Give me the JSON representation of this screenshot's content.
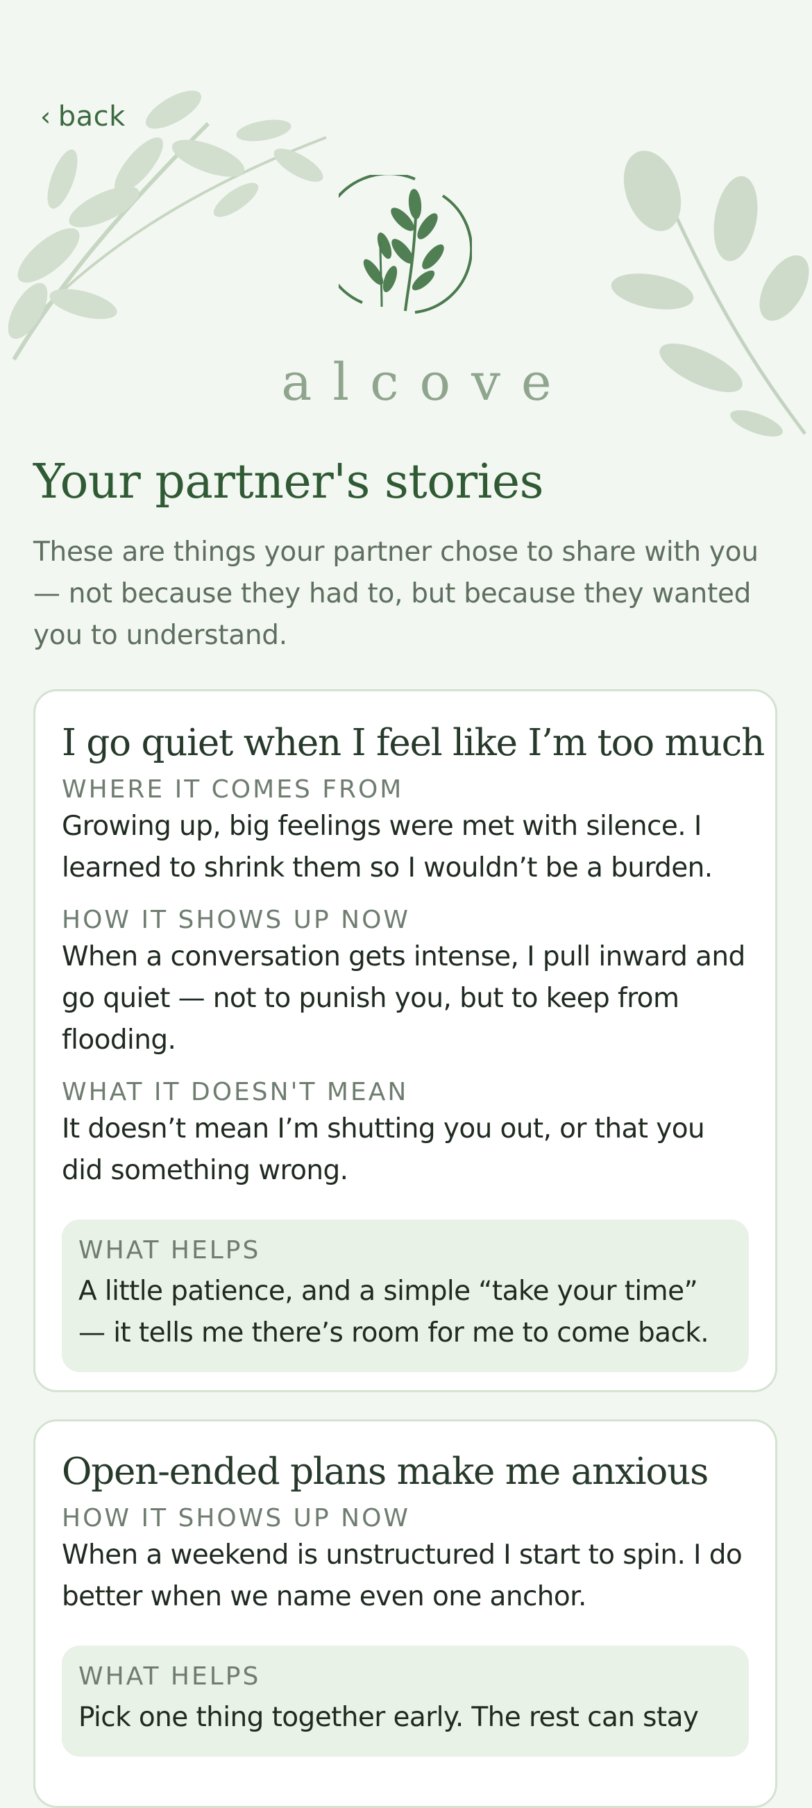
{
  "nav": {
    "back_label": "back",
    "back_icon": "chevron-left-icon"
  },
  "brand": {
    "name": "alcove",
    "logo_icon": "sprig-emblem-icon"
  },
  "page": {
    "title": "Your partner's stories",
    "intro": "These are things your partner chose to share with you — not because they had to, but because they wanted you to understand."
  },
  "stories": [
    {
      "title": "I go quiet when I feel like I’m too much",
      "sections": [
        {
          "label": "WHERE IT COMES FROM",
          "text": "Growing up, big feelings were met with silence. I learned to shrink them so I wouldn’t be a burden."
        },
        {
          "label": "HOW IT SHOWS UP NOW",
          "text": "When a conversation gets intense, I pull inward and go quiet — not to punish you, but to keep from flooding."
        },
        {
          "label": "WHAT IT DOESN'T MEAN",
          "text": "It doesn’t mean I’m shutting you out, or that you did something wrong."
        }
      ],
      "helps": {
        "label": "WHAT HELPS",
        "text": "A little patience, and a simple “take your time” — it tells me there’s room for me to come back."
      }
    },
    {
      "title": "Open-ended plans make me anxious",
      "sections": [
        {
          "label": "HOW IT SHOWS UP NOW",
          "text": "When a weekend is unstructured I start to spin. I do better when we name even one anchor."
        }
      ],
      "helps": {
        "label": "WHAT HELPS",
        "text": "Pick one thing together early. The rest can stay"
      }
    }
  ],
  "colors": {
    "background": "#f3f7f1",
    "accent_green": "#2f5a34",
    "card_border": "#d3e3d0",
    "helps_background": "#e9f2e6",
    "muted_text": "#5e6f5f"
  }
}
